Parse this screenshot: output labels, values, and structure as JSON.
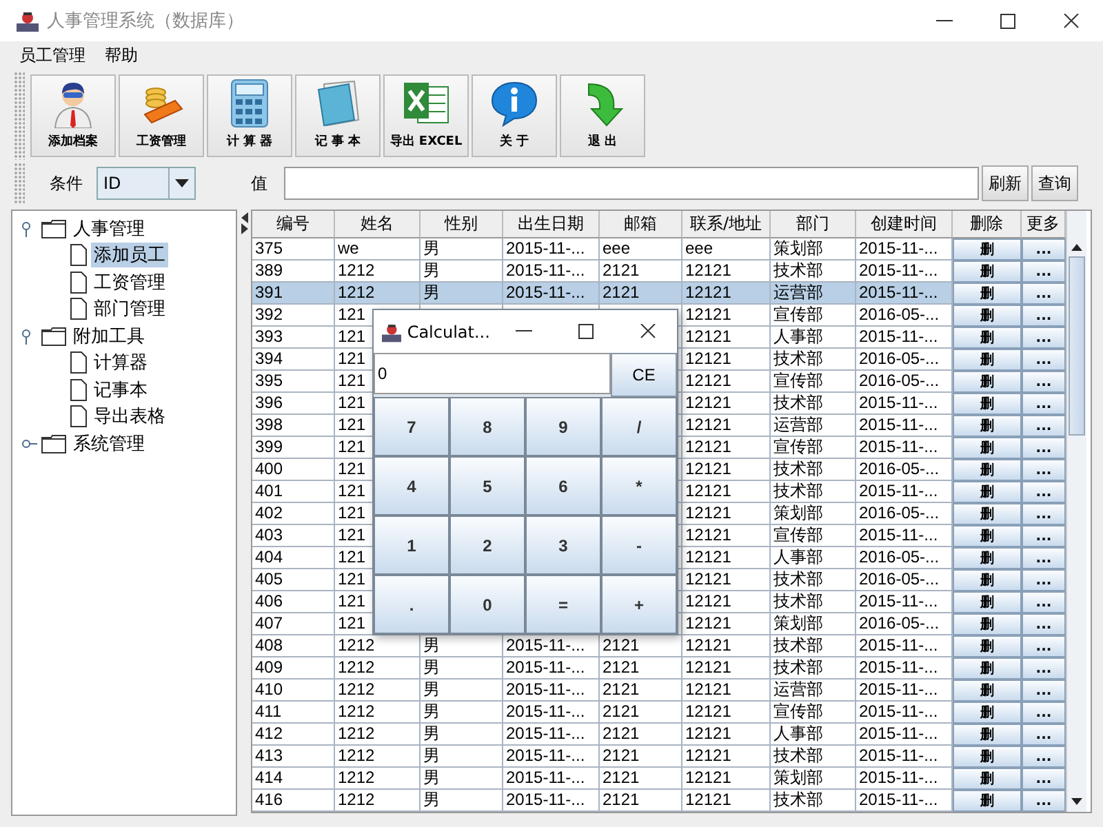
{
  "window": {
    "title": "人事管理系统（数据库）"
  },
  "menu": [
    {
      "label": "员工管理"
    },
    {
      "label": "帮助"
    }
  ],
  "toolbar": [
    {
      "label": "添加档案"
    },
    {
      "label": "工资管理"
    },
    {
      "label": "计 算 器"
    },
    {
      "label": "记 事 本"
    },
    {
      "label": "导出 EXCEL"
    },
    {
      "label": "关 于"
    },
    {
      "label": "退 出"
    }
  ],
  "search": {
    "condition_label": "条件",
    "condition_value": "ID",
    "value_label": "值",
    "buttons": [
      "刷新",
      "查询"
    ]
  },
  "tree": [
    {
      "label": "人事管理",
      "expanded": true,
      "selected": false,
      "children": [
        {
          "label": "添加员工",
          "selected": true
        },
        {
          "label": "工资管理",
          "selected": false
        },
        {
          "label": "部门管理",
          "selected": false
        }
      ]
    },
    {
      "label": "附加工具",
      "expanded": true,
      "selected": false,
      "children": [
        {
          "label": "计算器",
          "selected": false
        },
        {
          "label": "记事本",
          "selected": false
        },
        {
          "label": "导出表格",
          "selected": false
        }
      ]
    },
    {
      "label": "系统管理",
      "expanded": false,
      "selected": false
    }
  ],
  "table": {
    "columns": [
      "编号",
      "姓名",
      "性别",
      "出生日期",
      "邮箱",
      "联系/地址",
      "部门",
      "创建时间",
      "删除",
      "更多"
    ],
    "rows": [
      {
        "id": "375",
        "name": "we",
        "gender": "男",
        "birth": "2015-11-...",
        "email": "eee",
        "contact": "eee",
        "dept": "策划部",
        "created": "2015-11-...",
        "delete": "删",
        "more": "...",
        "selected": false
      },
      {
        "id": "389",
        "name": "1212",
        "gender": "男",
        "birth": "2015-11-...",
        "email": "2121",
        "contact": "12121",
        "dept": "技术部",
        "created": "2015-11-...",
        "delete": "删",
        "more": "...",
        "selected": false
      },
      {
        "id": "391",
        "name": "1212",
        "gender": "男",
        "birth": "2015-11-...",
        "email": "2121",
        "contact": "12121",
        "dept": "运营部",
        "created": "2015-11-...",
        "delete": "删",
        "more": "...",
        "selected": true
      },
      {
        "id": "392",
        "name": "121",
        "contact": "12121",
        "dept": "宣传部",
        "created": "2016-05-...",
        "delete": "删",
        "more": "...",
        "selected": false
      },
      {
        "id": "393",
        "name": "121",
        "contact": "12121",
        "dept": "人事部",
        "created": "2015-11-...",
        "delete": "删",
        "more": "...",
        "selected": false
      },
      {
        "id": "394",
        "name": "121",
        "contact": "12121",
        "dept": "技术部",
        "created": "2016-05-...",
        "delete": "删",
        "more": "...",
        "selected": false
      },
      {
        "id": "395",
        "name": "121",
        "contact": "12121",
        "dept": "宣传部",
        "created": "2016-05-...",
        "delete": "删",
        "more": "...",
        "selected": false
      },
      {
        "id": "396",
        "name": "121",
        "contact": "12121",
        "dept": "技术部",
        "created": "2015-11-...",
        "delete": "删",
        "more": "...",
        "selected": false
      },
      {
        "id": "398",
        "name": "121",
        "contact": "12121",
        "dept": "运营部",
        "created": "2015-11-...",
        "delete": "删",
        "more": "...",
        "selected": false
      },
      {
        "id": "399",
        "name": "121",
        "contact": "12121",
        "dept": "宣传部",
        "created": "2015-11-...",
        "delete": "删",
        "more": "...",
        "selected": false
      },
      {
        "id": "400",
        "name": "121",
        "contact": "12121",
        "dept": "技术部",
        "created": "2016-05-...",
        "delete": "删",
        "more": "...",
        "selected": false
      },
      {
        "id": "401",
        "name": "121",
        "contact": "12121",
        "dept": "技术部",
        "created": "2015-11-...",
        "delete": "删",
        "more": "...",
        "selected": false
      },
      {
        "id": "402",
        "name": "121",
        "contact": "12121",
        "dept": "策划部",
        "created": "2016-05-...",
        "delete": "删",
        "more": "...",
        "selected": false
      },
      {
        "id": "403",
        "name": "121",
        "contact": "12121",
        "dept": "宣传部",
        "created": "2015-11-...",
        "delete": "删",
        "more": "...",
        "selected": false
      },
      {
        "id": "404",
        "name": "121",
        "contact": "12121",
        "dept": "人事部",
        "created": "2016-05-...",
        "delete": "删",
        "more": "...",
        "selected": false
      },
      {
        "id": "405",
        "name": "121",
        "contact": "12121",
        "dept": "技术部",
        "created": "2016-05-...",
        "delete": "删",
        "more": "...",
        "selected": false
      },
      {
        "id": "406",
        "name": "121",
        "contact": "12121",
        "dept": "技术部",
        "created": "2015-11-...",
        "delete": "删",
        "more": "...",
        "selected": false
      },
      {
        "id": "407",
        "name": "121",
        "contact": "12121",
        "dept": "策划部",
        "created": "2016-05-...",
        "delete": "删",
        "more": "...",
        "selected": false
      },
      {
        "id": "408",
        "name": "1212",
        "gender": "男",
        "birth": "2015-11-...",
        "email": "2121",
        "contact": "12121",
        "dept": "技术部",
        "created": "2015-11-...",
        "delete": "删",
        "more": "...",
        "selected": false
      },
      {
        "id": "409",
        "name": "1212",
        "gender": "男",
        "birth": "2015-11-...",
        "email": "2121",
        "contact": "12121",
        "dept": "技术部",
        "created": "2015-11-...",
        "delete": "删",
        "more": "...",
        "selected": false
      },
      {
        "id": "410",
        "name": "1212",
        "gender": "男",
        "birth": "2015-11-...",
        "email": "2121",
        "contact": "12121",
        "dept": "运营部",
        "created": "2015-11-...",
        "delete": "删",
        "more": "...",
        "selected": false
      },
      {
        "id": "411",
        "name": "1212",
        "gender": "男",
        "birth": "2015-11-...",
        "email": "2121",
        "contact": "12121",
        "dept": "宣传部",
        "created": "2015-11-...",
        "delete": "删",
        "more": "...",
        "selected": false
      },
      {
        "id": "412",
        "name": "1212",
        "gender": "男",
        "birth": "2015-11-...",
        "email": "2121",
        "contact": "12121",
        "dept": "人事部",
        "created": "2015-11-...",
        "delete": "删",
        "more": "...",
        "selected": false
      },
      {
        "id": "413",
        "name": "1212",
        "gender": "男",
        "birth": "2015-11-...",
        "email": "2121",
        "contact": "12121",
        "dept": "技术部",
        "created": "2015-11-...",
        "delete": "删",
        "more": "...",
        "selected": false
      },
      {
        "id": "414",
        "name": "1212",
        "gender": "男",
        "birth": "2015-11-...",
        "email": "2121",
        "contact": "12121",
        "dept": "策划部",
        "created": "2015-11-...",
        "delete": "删",
        "more": "...",
        "selected": false
      },
      {
        "id": "416",
        "name": "1212",
        "gender": "男",
        "birth": "2015-11-...",
        "email": "2121",
        "contact": "12121",
        "dept": "技术部",
        "created": "2015-11-...",
        "delete": "删",
        "more": "...",
        "selected": false
      }
    ]
  },
  "calculator": {
    "title": "Calculat...",
    "display": "0",
    "clear": "CE",
    "keys": [
      "7",
      "8",
      "9",
      "/",
      "4",
      "5",
      "6",
      "*",
      "1",
      "2",
      "3",
      "-",
      ".",
      "0",
      "=",
      "+"
    ]
  }
}
